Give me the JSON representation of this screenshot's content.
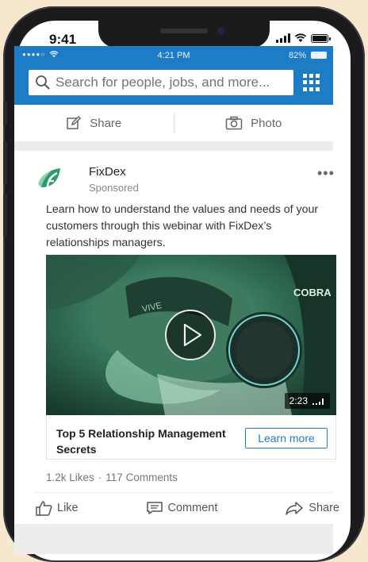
{
  "device": {
    "time": "9:41",
    "battery_level": 1.0
  },
  "app_status": {
    "dots": "●●●●○",
    "time": "4:21 PM",
    "battery": "82%"
  },
  "search": {
    "placeholder": "Search for people, jobs, and more..."
  },
  "share_bar": {
    "share_label": "Share",
    "photo_label": "Photo"
  },
  "post": {
    "company": "FixDex",
    "sponsored_label": "Sponsored",
    "more": "•••",
    "text": "Learn how to understand the values and needs of your customers through this webinar with FixDex’s relationships managers.",
    "video": {
      "duration": "2:23",
      "overlay_text_left": "VIVE",
      "overlay_text_right": "COBRA"
    },
    "ad_title": "Top 5 Relationship Management Secrets",
    "cta_label": "Learn more",
    "likes": "1.2k Likes",
    "separator": "·",
    "comments": "117 Comments",
    "actions": {
      "like": "Like",
      "comment": "Comment",
      "share": "Share"
    }
  },
  "colors": {
    "brand_blue": "#1d7cc4",
    "logo_green": "#2e9a6a",
    "background": "#f7e7cf"
  }
}
